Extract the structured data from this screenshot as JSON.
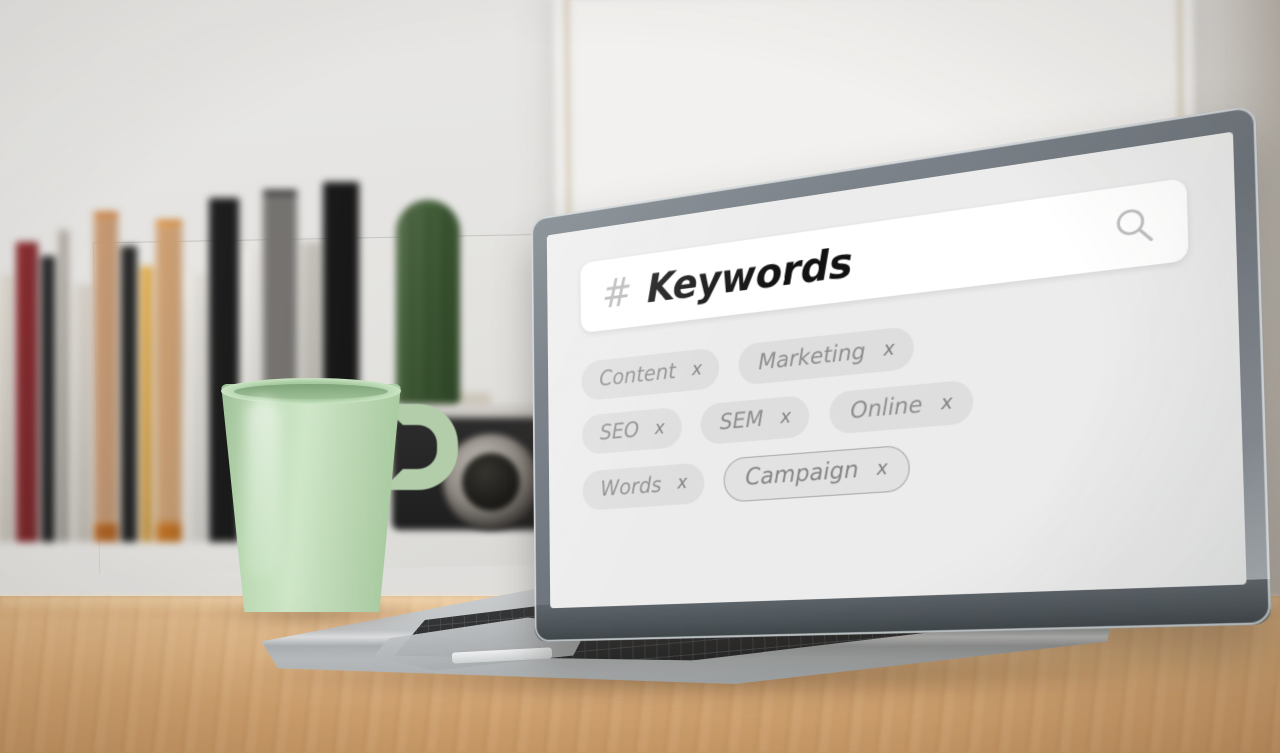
{
  "scene": {
    "title": "Keyword search interface on laptop screen",
    "desk_color": "#d9ac78",
    "wall_color": "#e7e6e4"
  },
  "objects": {
    "mug": {
      "name": "coffee-mug",
      "color": "#bedcb6"
    },
    "books": {
      "name": "book-stack",
      "spine_colors": [
        "#e7e2d8",
        "#8e2f33",
        "#2b2b2b",
        "#b9b4ab",
        "#e0dcd3",
        "#c9742c",
        "#2a2a2a",
        "#e8b55a",
        "#d9822b",
        "#efece6",
        "#1f1f1f",
        "#f2f0ec",
        "#262626",
        "#cfcbc4",
        "#1a1a1a"
      ]
    },
    "cactus": {
      "name": "cactus-plant",
      "color": "#46603c"
    },
    "camera": {
      "name": "vintage-camera",
      "color": "#262626"
    },
    "picture_frame": {
      "name": "picture-frame",
      "color": "#efeeec"
    },
    "laptop": {
      "name": "laptop",
      "body_color": "#c2c5c7",
      "bezel_color": "#7c838a"
    }
  },
  "screen": {
    "search": {
      "hash_symbol": "#",
      "query": "Keywords",
      "placeholder": "Keywords",
      "search_icon": "magnifier-icon"
    },
    "tag_rows": [
      [
        {
          "label": "Content",
          "remove": "x",
          "selected": false
        },
        {
          "label": "Marketing",
          "remove": "x",
          "selected": false
        }
      ],
      [
        {
          "label": "SEO",
          "remove": "x",
          "selected": false
        },
        {
          "label": "SEM",
          "remove": "x",
          "selected": false
        },
        {
          "label": "Online",
          "remove": "x",
          "selected": false
        }
      ],
      [
        {
          "label": "Words",
          "remove": "x",
          "selected": false
        },
        {
          "label": "Campaign",
          "remove": "x",
          "selected": true
        }
      ]
    ],
    "colors": {
      "background": "#ececec",
      "searchbar": "#ffffff",
      "tag_fill": "#dedede",
      "tag_text": "#8d8d8d",
      "query_text": "#121212",
      "selected_outline": "#a8a8a8"
    }
  }
}
